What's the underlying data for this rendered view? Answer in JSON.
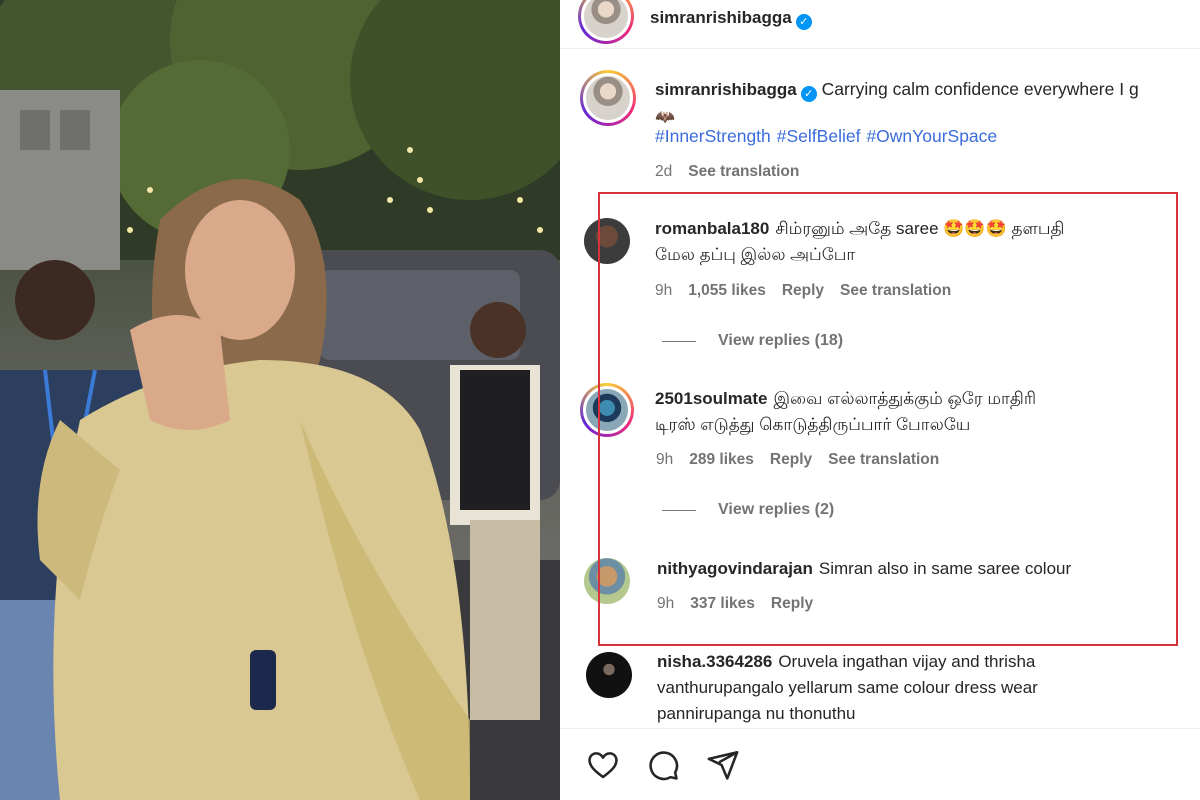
{
  "post": {
    "author": "simranrishibagga",
    "caption_text": "Carrying calm confidence everywhere I g",
    "caption_emoji": "🦇",
    "hashtags": [
      "#InnerStrength",
      "#SelfBelief",
      "#OwnYourSpace"
    ],
    "time": "2d",
    "see_translation": "See translation"
  },
  "comments": [
    {
      "username": "romanbala180",
      "text_line1": "சிம்ரனும் அதே saree 🤩🤩🤩 தளபதி",
      "text_line2": "மேல தப்பு இல்ல அப்போ",
      "time": "9h",
      "likes": "1,055 likes",
      "reply": "Reply",
      "see_translation": "See translation",
      "view_replies": "View replies (18)"
    },
    {
      "username": "2501soulmate",
      "text_line1": "இவை எல்லாத்துக்கும் ஒரே மாதிரி",
      "text_line2": "டிரஸ் எடுத்து கொடுத்திருப்பார் போலயே",
      "time": "9h",
      "likes": "289 likes",
      "reply": "Reply",
      "see_translation": "See translation",
      "view_replies": "View replies (2)"
    },
    {
      "username": "nithyagovindarajan",
      "text_line1": "Simran also in same saree colour",
      "time": "9h",
      "likes": "337 likes",
      "reply": "Reply"
    },
    {
      "username": "nisha.3364286",
      "text_line1": "Oruvela ingathan vijay and thrisha",
      "text_line2": "vanthurupangalo yellarum same colour dress wear",
      "text_line3": "pannirupanga nu thonuthu"
    }
  ],
  "actions": {
    "icons": [
      "heart-icon",
      "comment-icon",
      "share-icon"
    ]
  },
  "colors": {
    "link": "#3b6cdb",
    "verified": "#0095f6",
    "highlight_box": "#d6343a",
    "muted": "#737373"
  }
}
